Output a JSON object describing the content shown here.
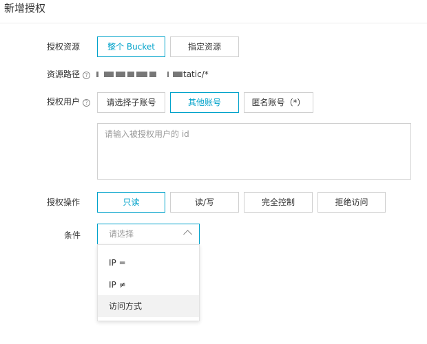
{
  "header": {
    "title": "新增授权"
  },
  "form": {
    "resource": {
      "label": "授权资源",
      "options": [
        "整个 Bucket",
        "指定资源"
      ],
      "selected": "整个 Bucket"
    },
    "path": {
      "label": "资源路径",
      "help_icon": "?",
      "value_suffix": "tatic/*"
    },
    "user": {
      "label": "授权用户",
      "help_icon": "?",
      "options": [
        "请选择子账号",
        "其他账号",
        "匿名账号（*）"
      ],
      "selected": "其他账号",
      "id_placeholder": "请输入被授权用户的 id"
    },
    "action": {
      "label": "授权操作",
      "options": [
        "只读",
        "读/写",
        "完全控制",
        "拒绝访问"
      ],
      "selected": "只读"
    },
    "condition": {
      "label": "条件",
      "placeholder": "请选择",
      "dropdown_options": [
        "IP =",
        "IP ≠",
        "访问方式"
      ],
      "hovered_option": "访问方式"
    }
  },
  "colors": {
    "accent": "#00a2ca",
    "border": "#d0d0d0"
  }
}
